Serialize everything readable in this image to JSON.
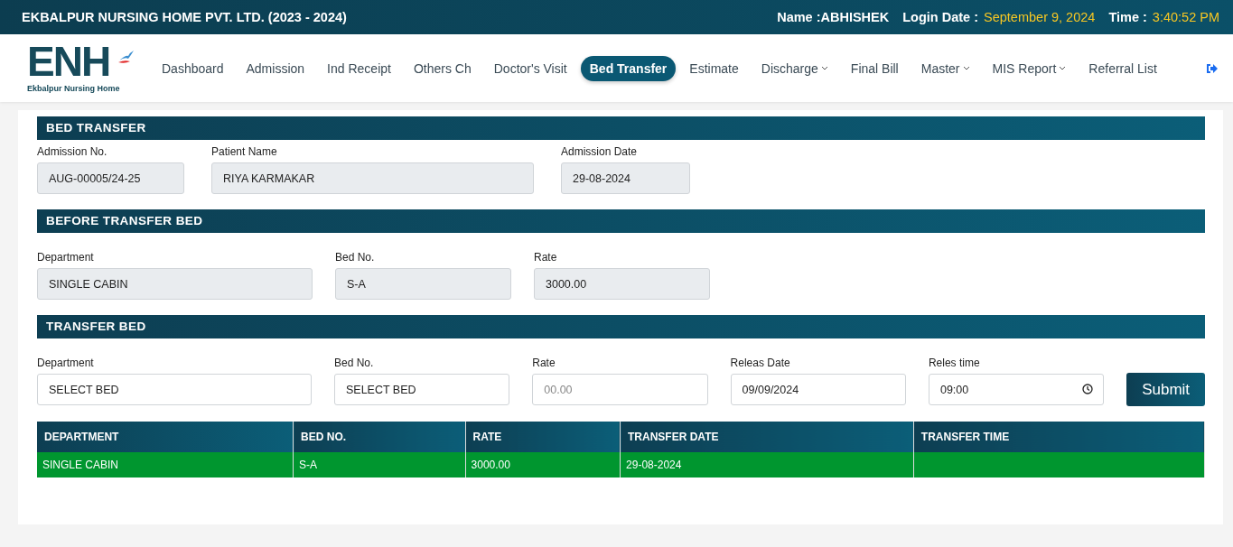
{
  "header": {
    "title": "EKBALPUR NURSING HOME PVT. LTD. (2023 - 2024)",
    "user_label": "Name :",
    "user": "ABHISHEK",
    "login_label": "Login Date :",
    "login_date": "September 9, 2024",
    "time_label": "Time :",
    "time": "3:40:52 PM"
  },
  "logo": {
    "mark": "ENH",
    "name": "Ekbalpur Nursing Home"
  },
  "nav": [
    {
      "label": "Dashboard",
      "selected": false,
      "dropdown": false
    },
    {
      "label": "Admission",
      "selected": false,
      "dropdown": false
    },
    {
      "label": "Ind Receipt",
      "selected": false,
      "dropdown": false
    },
    {
      "label": "Others Ch",
      "selected": false,
      "dropdown": false
    },
    {
      "label": "Doctor's Visit",
      "selected": false,
      "dropdown": false
    },
    {
      "label": "Bed Transfer",
      "selected": true,
      "dropdown": false
    },
    {
      "label": "Estimate",
      "selected": false,
      "dropdown": false
    },
    {
      "label": "Discharge",
      "selected": false,
      "dropdown": true
    },
    {
      "label": "Final Bill",
      "selected": false,
      "dropdown": false
    },
    {
      "label": "Master",
      "selected": false,
      "dropdown": true
    },
    {
      "label": "MIS Report",
      "selected": false,
      "dropdown": true
    },
    {
      "label": "Referral List",
      "selected": false,
      "dropdown": false
    }
  ],
  "sections": [
    {
      "title": "BED TRANSFER",
      "fields": [
        {
          "label": "Admission No.",
          "kind": "text",
          "readonly": true,
          "value": "AUG-00005/24-25"
        },
        {
          "label": "Patient Name",
          "kind": "text",
          "readonly": true,
          "value": "RIYA KARMAKAR"
        },
        {
          "label": "Admission Date",
          "kind": "text",
          "readonly": true,
          "value": "29-08-2024"
        }
      ]
    },
    {
      "title": "BEFORE TRANSFER BED",
      "fields": [
        {
          "label": "Department",
          "kind": "text",
          "readonly": true,
          "value": "SINGLE CABIN"
        },
        {
          "label": "Bed No.",
          "kind": "text",
          "readonly": true,
          "value": "S-A"
        },
        {
          "label": "Rate",
          "kind": "text",
          "readonly": true,
          "value": "3000.00"
        }
      ]
    },
    {
      "title": "TRANSFER BED",
      "fields": [
        {
          "label": "Department",
          "kind": "text",
          "readonly": false,
          "value": "SELECT BED"
        },
        {
          "label": "Bed No.",
          "kind": "text",
          "readonly": false,
          "value": "SELECT BED"
        },
        {
          "label": "Rate",
          "kind": "text",
          "readonly": false,
          "placeholder": "00.00"
        },
        {
          "label": "Releas Date",
          "kind": "text",
          "readonly": false,
          "value": "09/09/2024"
        },
        {
          "label": "Reles time",
          "kind": "time",
          "readonly": false,
          "value": "09:00"
        }
      ],
      "button": "Submit"
    }
  ],
  "table": {
    "columns": [
      "DEPARTMENT",
      "BED NO.",
      "RATE",
      "TRANSFER DATE",
      "TRANSFER TIME"
    ],
    "rows": [
      [
        "SINGLE CABIN",
        "S-A",
        "3000.00",
        "29-08-2024",
        ""
      ]
    ]
  }
}
